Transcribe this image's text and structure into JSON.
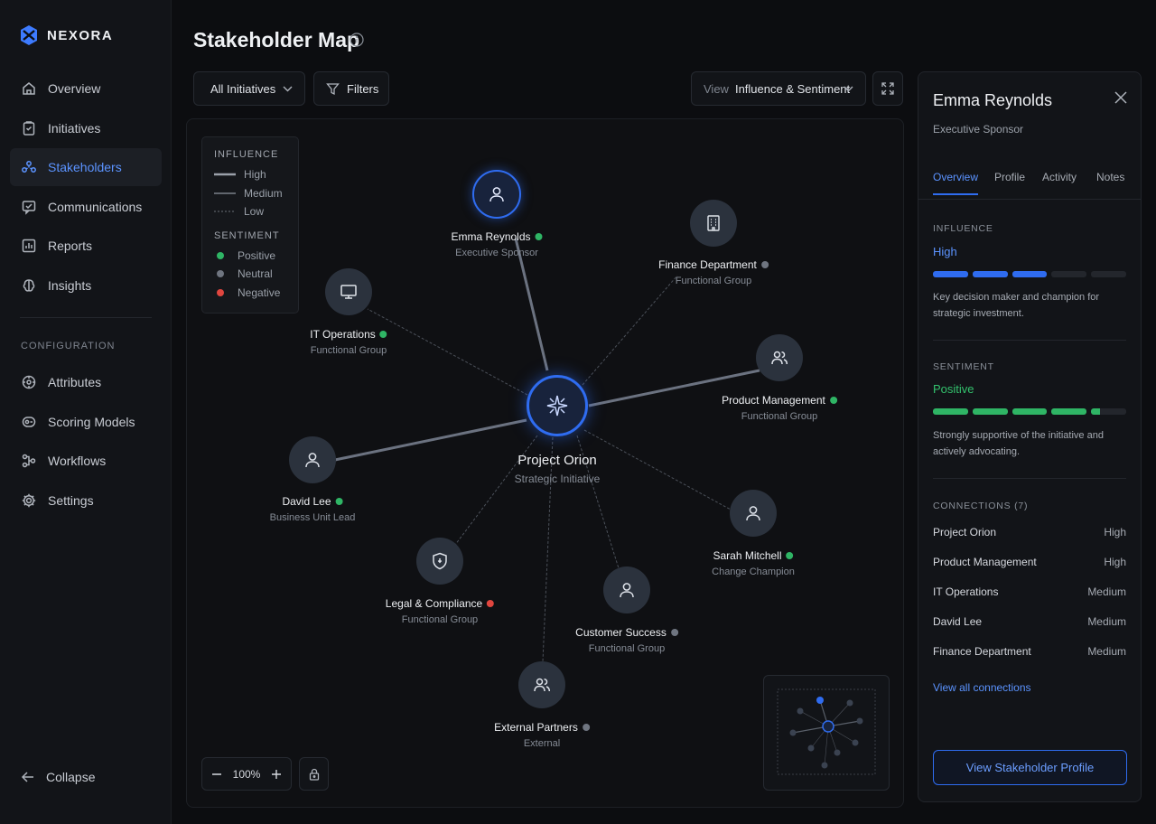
{
  "brand": {
    "name": "NEXORA"
  },
  "sidebar": {
    "items": [
      {
        "label": "Overview",
        "icon": "home-icon"
      },
      {
        "label": "Initiatives",
        "icon": "clipboard-icon"
      },
      {
        "label": "Stakeholders",
        "icon": "users-icon",
        "active": true
      },
      {
        "label": "Communications",
        "icon": "message-icon"
      },
      {
        "label": "Reports",
        "icon": "bar-chart-icon"
      },
      {
        "label": "Insights",
        "icon": "brain-icon"
      }
    ],
    "section_label": "CONFIGURATION",
    "config_items": [
      {
        "label": "Attributes",
        "icon": "tag-icon"
      },
      {
        "label": "Scoring Models",
        "icon": "scoring-icon"
      },
      {
        "label": "Workflows",
        "icon": "workflow-icon"
      },
      {
        "label": "Settings",
        "icon": "gear-icon"
      }
    ],
    "collapse_label": "Collapse"
  },
  "header": {
    "title": "Stakeholder Map",
    "initiative_filter": "All Initiatives",
    "filters_label": "Filters",
    "view_prefix": "View",
    "view_value": "Influence & Sentiment"
  },
  "legend": {
    "influence_heading": "INFLUENCE",
    "influence": [
      "High",
      "Medium",
      "Low"
    ],
    "sentiment_heading": "SENTIMENT",
    "sentiment": [
      "Positive",
      "Neutral",
      "Negative"
    ]
  },
  "colors": {
    "accent": "#2f6cf0",
    "positive": "#2fb565",
    "neutral": "#6f7580",
    "negative": "#e0463f"
  },
  "map": {
    "center": {
      "name": "Project Orion",
      "subtitle": "Strategic Initiative"
    },
    "nodes": [
      {
        "name": "Emma Reynolds",
        "subtitle": "Executive Sponsor",
        "sentiment": "positive",
        "influence": "high",
        "icon": "user-icon"
      },
      {
        "name": "Finance Department",
        "subtitle": "Functional Group",
        "sentiment": "neutral",
        "influence": "low",
        "icon": "building-icon"
      },
      {
        "name": "IT Operations",
        "subtitle": "Functional Group",
        "sentiment": "positive",
        "influence": "low",
        "icon": "monitor-icon"
      },
      {
        "name": "Product Management",
        "subtitle": "Functional Group",
        "sentiment": "positive",
        "influence": "high",
        "icon": "users-icon"
      },
      {
        "name": "David Lee",
        "subtitle": "Business Unit Lead",
        "sentiment": "positive",
        "influence": "high",
        "icon": "user-icon"
      },
      {
        "name": "Sarah Mitchell",
        "subtitle": "Change Champion",
        "sentiment": "positive",
        "influence": "low",
        "icon": "user-icon"
      },
      {
        "name": "Legal & Compliance",
        "subtitle": "Functional Group",
        "sentiment": "negative",
        "influence": "low",
        "icon": "shield-icon"
      },
      {
        "name": "Customer Success",
        "subtitle": "Functional Group",
        "sentiment": "neutral",
        "influence": "low",
        "icon": "user-icon"
      },
      {
        "name": "External Partners",
        "subtitle": "External",
        "sentiment": "neutral",
        "influence": "low",
        "icon": "users-icon"
      }
    ],
    "zoom": "100%"
  },
  "panel": {
    "name": "Emma Reynolds",
    "role": "Executive Sponsor",
    "tabs": [
      "Overview",
      "Profile",
      "Activity",
      "Notes"
    ],
    "influence": {
      "heading": "INFLUENCE",
      "value": "High",
      "level_fraction": 0.6,
      "description": "Key decision maker and champion for strategic investment."
    },
    "sentiment": {
      "heading": "SENTIMENT",
      "value": "Positive",
      "level_fraction": 0.85,
      "description": "Strongly supportive of the initiative and actively advocating."
    },
    "connections_heading": "CONNECTIONS (7)",
    "connections": [
      {
        "name": "Project Orion",
        "level": "High"
      },
      {
        "name": "Product Management",
        "level": "High"
      },
      {
        "name": "IT Operations",
        "level": "Medium"
      },
      {
        "name": "David Lee",
        "level": "Medium"
      },
      {
        "name": "Finance Department",
        "level": "Medium"
      }
    ],
    "view_all_label": "View all connections",
    "profile_button": "View Stakeholder Profile"
  }
}
